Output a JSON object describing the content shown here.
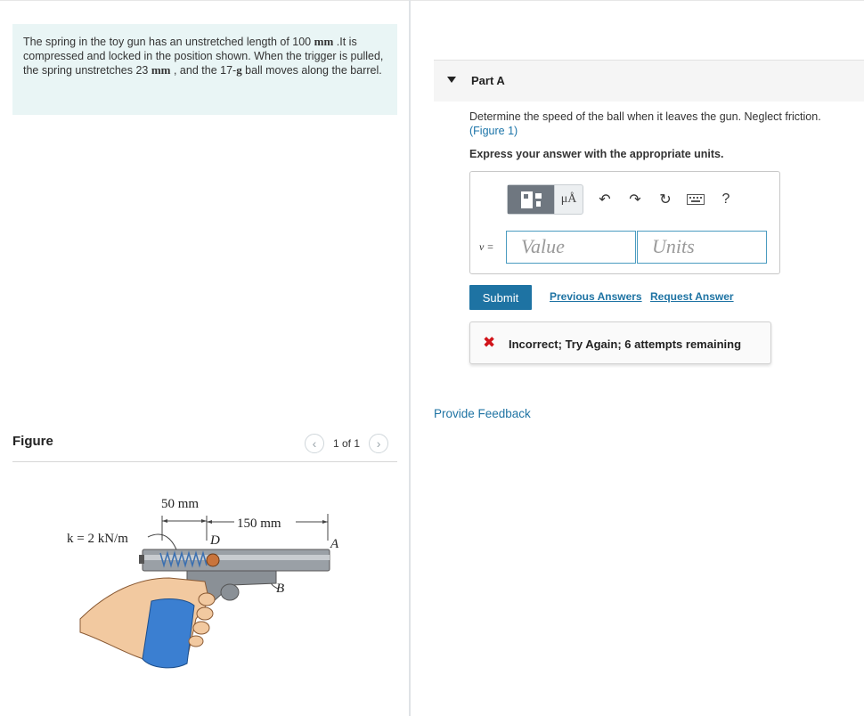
{
  "problem": {
    "text_1": "The spring in the toy gun has an unstretched length of 100 ",
    "unit_1": "mm",
    "text_2": " .It is compressed and locked in the position shown. When the trigger is pulled, the spring unstretches 23 ",
    "unit_2": "mm",
    "text_3": " , and the 17-",
    "unit_3": "g",
    "text_4": " ball moves along the barrel."
  },
  "figure": {
    "title": "Figure",
    "pager": "1 of 1",
    "prev_icon": "chevron-left-icon",
    "next_icon": "chevron-right-icon",
    "labels": {
      "dim_50": "50 mm",
      "dim_150": "150 mm",
      "k": "k = 2 kN/m",
      "D": "D",
      "A": "A",
      "B": "B"
    }
  },
  "part_a": {
    "label": "Part A",
    "question": "Determine the speed of the ball when it leaves the gun. Neglect friction.",
    "figure_link": "(Figure 1)",
    "express": "Express your answer with the appropriate units.",
    "toolbar": {
      "templates_icon": "templates-icon",
      "units_symbol": "μÅ",
      "undo_icon": "undo-icon",
      "redo_icon": "redo-icon",
      "reset_icon": "reset-icon",
      "keyboard_icon": "keyboard-icon",
      "help": "?"
    },
    "variable": "v =",
    "value_placeholder": "Value",
    "units_placeholder": "Units",
    "submit": "Submit",
    "previous_answers": "Previous Answers",
    "request_answer": "Request Answer",
    "feedback_mark": "✖",
    "feedback": "Incorrect; Try Again; 6 attempts remaining"
  },
  "provide_feedback": "Provide Feedback",
  "colors": {
    "accent": "#1e73a3",
    "problem_bg": "#e9f5f5",
    "error": "#d1141a"
  }
}
